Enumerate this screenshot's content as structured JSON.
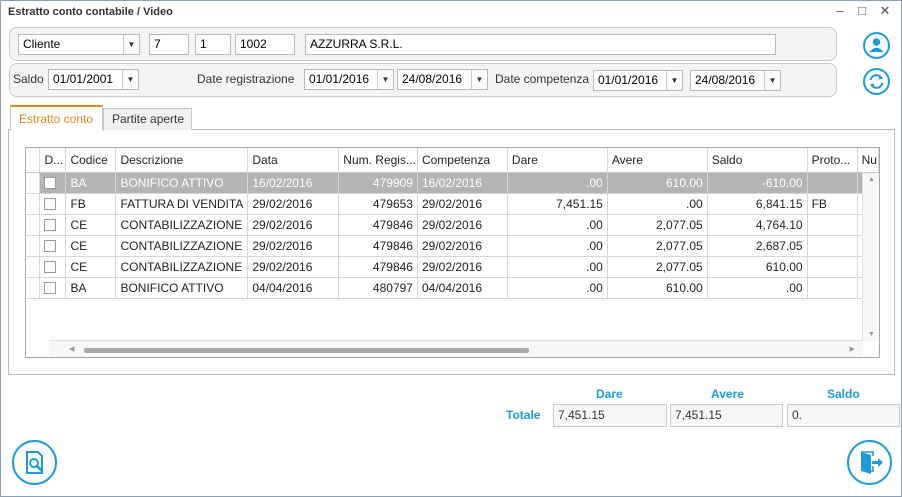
{
  "window": {
    "title": "Estratto conto contabile / Video",
    "controls": [
      "–",
      "□",
      "✕"
    ]
  },
  "header": {
    "account_type": "Cliente",
    "code1": "7",
    "code2": "1",
    "code3": "1002",
    "account_name": "AZZURRA S.R.L."
  },
  "filters": {
    "saldo_label": "Saldo",
    "saldo_date": "01/01/2001",
    "reg_label": "Date registrazione",
    "reg_from": "01/01/2016",
    "reg_to": "24/08/2016",
    "comp_label": "Date competenza",
    "comp_from": "01/01/2016",
    "comp_to": "24/08/2016"
  },
  "tabs": [
    {
      "label": "Estratto conto",
      "active": true
    },
    {
      "label": "Partite aperte",
      "active": false
    }
  ],
  "grid": {
    "columns": [
      "D...",
      "Codice",
      "Descrizione",
      "Data",
      "Num. Regis...",
      "Competenza",
      "Dare",
      "Avere",
      "Saldo",
      "Proto...",
      "Nu"
    ],
    "rows": [
      {
        "codice": "BA",
        "descrizione": "BONIFICO ATTIVO",
        "data": "16/02/2016",
        "num": "479909",
        "competenza": "16/02/2016",
        "dare": ".00",
        "avere": "610.00",
        "saldo": "-610.00",
        "proto": "",
        "selected": true
      },
      {
        "codice": "FB",
        "descrizione": "FATTURA DI VENDITA",
        "data": "29/02/2016",
        "num": "479653",
        "competenza": "29/02/2016",
        "dare": "7,451.15",
        "avere": ".00",
        "saldo": "6,841.15",
        "proto": "FB",
        "selected": false
      },
      {
        "codice": "CE",
        "descrizione": "CONTABILIZZAZIONE",
        "data": "29/02/2016",
        "num": "479846",
        "competenza": "29/02/2016",
        "dare": ".00",
        "avere": "2,077.05",
        "saldo": "4,764.10",
        "proto": "",
        "selected": false
      },
      {
        "codice": "CE",
        "descrizione": "CONTABILIZZAZIONE",
        "data": "29/02/2016",
        "num": "479846",
        "competenza": "29/02/2016",
        "dare": ".00",
        "avere": "2,077.05",
        "saldo": "2,687.05",
        "proto": "",
        "selected": false
      },
      {
        "codice": "CE",
        "descrizione": "CONTABILIZZAZIONE",
        "data": "29/02/2016",
        "num": "479846",
        "competenza": "29/02/2016",
        "dare": ".00",
        "avere": "2,077.05",
        "saldo": "610.00",
        "proto": "",
        "selected": false
      },
      {
        "codice": "BA",
        "descrizione": "BONIFICO ATTIVO",
        "data": "04/04/2016",
        "num": "480797",
        "competenza": "04/04/2016",
        "dare": ".00",
        "avere": "610.00",
        "saldo": ".00",
        "proto": "",
        "selected": false
      }
    ]
  },
  "totals": {
    "label": "Totale",
    "dare_label": "Dare",
    "avere_label": "Avere",
    "saldo_label": "Saldo",
    "dare": "7,451.15",
    "avere": "7,451.15",
    "saldo": "0."
  },
  "colors": {
    "accent": "#1e9ad6",
    "tab_active": "#e08a1e",
    "selected_row": "#b4b4b4"
  },
  "icons": {
    "customer": "user-icon",
    "refresh": "refresh-icon",
    "search_doc": "document-search-icon",
    "exit": "exit-icon"
  }
}
